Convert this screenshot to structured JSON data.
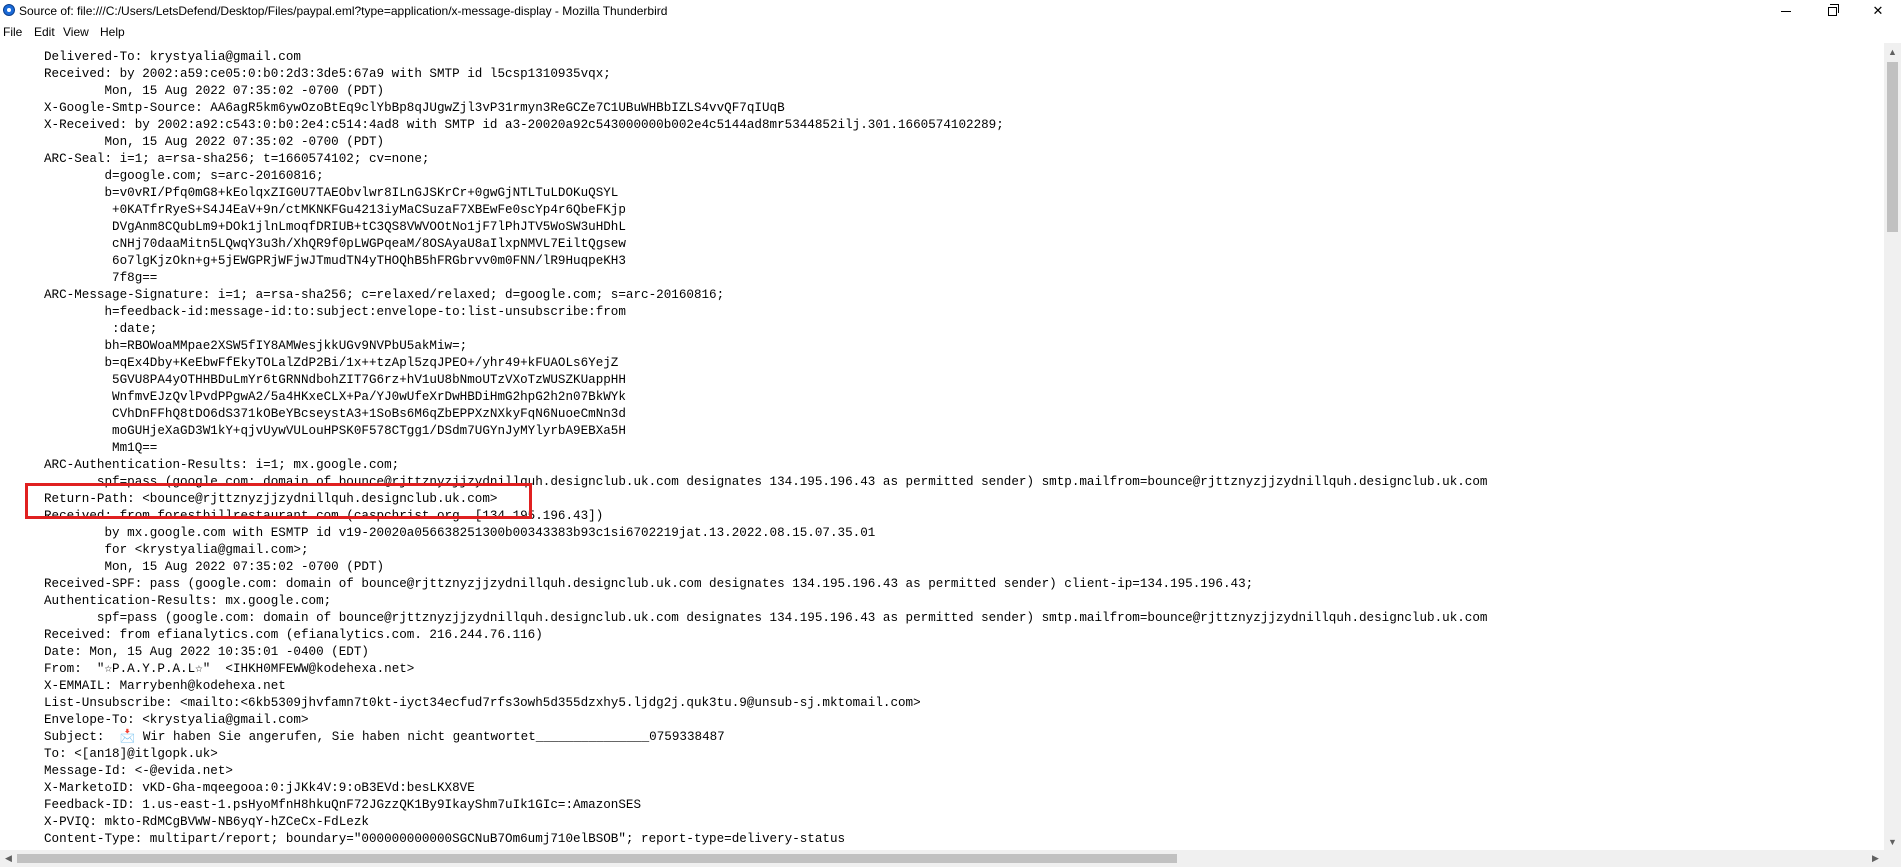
{
  "window": {
    "title": "Source of: file:///C:/Users/LetsDefend/Desktop/Files/paypal.eml?type=application/x-message-display - Mozilla Thunderbird",
    "minimize_glyph": "",
    "maximize_glyph": "",
    "close_glyph": "✕"
  },
  "menu": {
    "file": "File",
    "edit": "Edit",
    "view": "View",
    "help": "Help"
  },
  "source": {
    "lines": [
      "Delivered-To: krystyalia@gmail.com",
      "Received: by 2002:a59:ce05:0:b0:2d3:3de5:67a9 with SMTP id l5csp1310935vqx;",
      "        Mon, 15 Aug 2022 07:35:02 -0700 (PDT)",
      "X-Google-Smtp-Source: AA6agR5km6ywOzoBtEq9clYbBp8qJUgwZjl3vP31rmyn3ReGCZe7C1UBuWHBbIZLS4vvQF7qIUqB",
      "X-Received: by 2002:a92:c543:0:b0:2e4:c514:4ad8 with SMTP id a3-20020a92c543000000b002e4c5144ad8mr5344852ilj.301.1660574102289;",
      "        Mon, 15 Aug 2022 07:35:02 -0700 (PDT)",
      "ARC-Seal: i=1; a=rsa-sha256; t=1660574102; cv=none;",
      "        d=google.com; s=arc-20160816;",
      "        b=v0vRI/Pfq0mG8+kEolqxZIG0U7TAEObvlwr8ILnGJSKrCr+0gwGjNTLTuLDOKuQSYL",
      "         +0KATfrRyeS+S4J4EaV+9n/ctMKNKFGu4213iyMaCSuzaF7XBEwFe0scYp4r6QbeFKjp",
      "         DVgAnm8CQubLm9+DOk1jlnLmoqfDRIUB+tC3QS8VWVOOtNo1jF7lPhJTV5WoSW3uHDhL",
      "         cNHj70daaMitn5LQwqY3u3h/XhQR9f0pLWGPqeaM/8OSAyaU8aIlxpNMVL7EiltQgsew",
      "         6o7lgKjzOkn+g+5jEWGPRjWFjwJTmudTN4yTHOQhB5hFRGbrvv0m0FNN/lR9HuqpeKH3",
      "         7f8g==",
      "ARC-Message-Signature: i=1; a=rsa-sha256; c=relaxed/relaxed; d=google.com; s=arc-20160816;",
      "        h=feedback-id:message-id:to:subject:envelope-to:list-unsubscribe:from",
      "         :date;",
      "        bh=RBOWoaMMpae2XSW5fIY8AMWesjkkUGv9NVPbU5akMiw=;",
      "        b=qEx4Dby+KeEbwFfEkyTOLalZdP2Bi/1x++tzApl5zqJPEO+/yhr49+kFUAOLs6YejZ",
      "         5GVU8PA4yOTHHBDuLmYr6tGRNNdbohZIT7G6rz+hV1uU8bNmoUTzVXoTzWUSZKUappHH",
      "         WnfmvEJzQvlPvdPPgwA2/5a4HKxeCLX+Pa/YJ0wUfeXrDwHBDiHmG2hpG2h2n07BkWYk",
      "         CVhDnFFhQ8tDO6dS371kOBeYBcseystA3+1SoBs6M6qZbEPPXzNXkyFqN6NuoeCmNn3d",
      "         moGUHjeXaGD3W1kY+qjvUywVULouHPSK0F578CTgg1/DSdm7UGYnJyMYlyrbA9EBXa5H",
      "         Mm1Q==",
      "ARC-Authentication-Results: i=1; mx.google.com;",
      "       spf=pass (google.com: domain of bounce@rjttznyzjjzydnillquh.designclub.uk.com designates 134.195.196.43 as permitted sender) smtp.mailfrom=bounce@rjttznyzjjzydnillquh.designclub.uk.com",
      "Return-Path: <bounce@rjttznyzjjzydnillquh.designclub.uk.com>",
      "Received: from forestbillrestaurant.com (caspchrist.org. [134.195.196.43])",
      "        by mx.google.com with ESMTP id v19-20020a056638251300b00343383b93c1si6702219jat.13.2022.08.15.07.35.01",
      "        for <krystyalia@gmail.com>;",
      "        Mon, 15 Aug 2022 07:35:02 -0700 (PDT)",
      "Received-SPF: pass (google.com: domain of bounce@rjttznyzjjzydnillquh.designclub.uk.com designates 134.195.196.43 as permitted sender) client-ip=134.195.196.43;",
      "Authentication-Results: mx.google.com;",
      "       spf=pass (google.com: domain of bounce@rjttznyzjjzydnillquh.designclub.uk.com designates 134.195.196.43 as permitted sender) smtp.mailfrom=bounce@rjttznyzjjzydnillquh.designclub.uk.com",
      "Received: from efianalytics.com (efianalytics.com. 216.244.76.116)",
      "Date: Mon, 15 Aug 2022 10:35:01 -0400 (EDT)",
      "From:  \"☆P.A.Y.P.A.L☆\"  <IHKH0MFEWW@kodehexa.net>",
      "X-EMMAIL: Marrybenh@kodehexa.net",
      "List-Unsubscribe: <mailto:<6kb5309jhvfamn7t0kt-iyct34ecfud7rfs3owh5d355dzxhy5.ljdg2j.quk3tu.9@unsub-sj.mktomail.com>",
      "Envelope-To: <krystyalia@gmail.com>",
      "Subject:  📩 Wir haben Sie angerufen, Sie haben nicht geantwortet_______________0759338487",
      "To: <[an18]@itlgopk.uk>",
      "Message-Id: <-@evida.net>",
      "X-MarketoID: vKD-Gha-mqeegooa:0:jJKk4V:9:oB3EVd:besLKX8VE",
      "Feedback-ID: 1.us-east-1.psHyoMfnH8hkuQnF72JGzzQK1By9IkayShm7uIk1GIc=:AmazonSES",
      "X-PVIQ: mkto-RdMCgBVWW-NB6yqY-hZCeCx-FdLezk",
      "Content-Type: multipart/report; boundary=\"000000000000SGCNuB7Om6umj710elBSOB\"; report-type=delivery-status"
    ]
  },
  "colors": {
    "highlight": "#e02020",
    "scrollbar_track": "#f0f0f0",
    "scrollbar_thumb": "#c1c1c1"
  },
  "icons": {
    "app": "thunderbird-icon",
    "scroll_up": "chevron-up-icon",
    "scroll_down": "chevron-down-icon",
    "scroll_left": "chevron-left-icon",
    "scroll_right": "chevron-right-icon"
  }
}
